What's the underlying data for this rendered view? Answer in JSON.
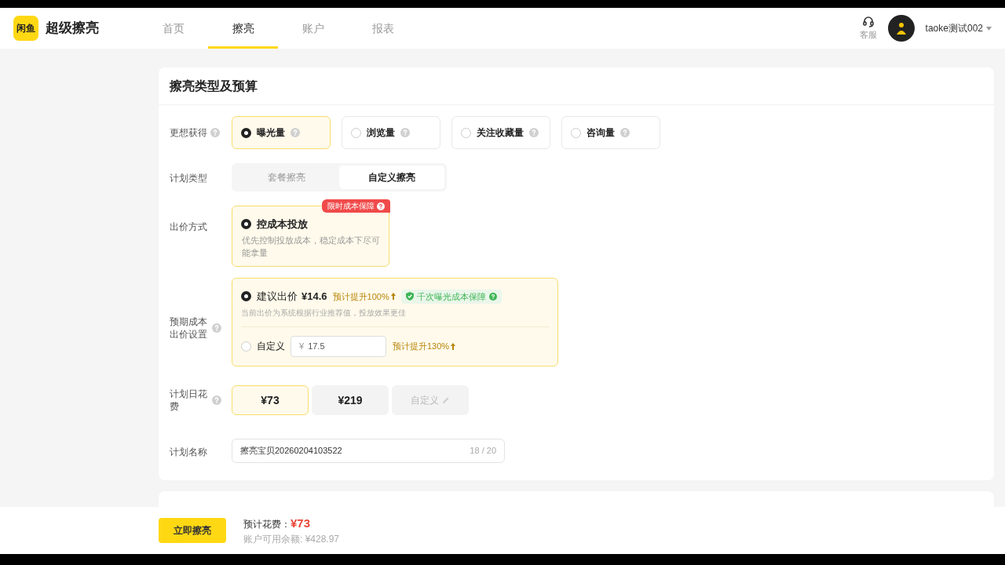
{
  "header": {
    "logo_text": "闲鱼",
    "brand": "超级擦亮",
    "nav": [
      {
        "label": "首页",
        "selected": false
      },
      {
        "label": "擦亮",
        "selected": true
      },
      {
        "label": "账户",
        "selected": false
      },
      {
        "label": "报表",
        "selected": false
      }
    ],
    "service": "客服",
    "username": "taoke测试002"
  },
  "card": {
    "title": "擦亮类型及预算",
    "goal": {
      "label": "更想获得",
      "options": [
        {
          "label": "曝光量",
          "selected": true
        },
        {
          "label": "浏览量",
          "selected": false
        },
        {
          "label": "关注收藏量",
          "selected": false
        },
        {
          "label": "咨询量",
          "selected": false
        }
      ]
    },
    "plan_type": {
      "label": "计划类型",
      "options": [
        {
          "label": "套餐擦亮",
          "selected": false
        },
        {
          "label": "自定义擦亮",
          "selected": true
        }
      ]
    },
    "bid_method": {
      "label": "出价方式",
      "badge": "限时成本保障",
      "title": "控成本投放",
      "description": "优先控制投放成本，稳定成本下尽可能拿量",
      "selected": true
    },
    "cost_setting": {
      "label": "预期成本出价设置",
      "suggested": {
        "selected": true,
        "label": "建议出价",
        "price": "¥14.6",
        "uplift": "预计提升100%",
        "guarantee": "千次曝光成本保障",
        "note": "当前出价为系统根据行业推荐值，投放效果更佳"
      },
      "custom": {
        "selected": false,
        "label": "自定义",
        "currency": "¥",
        "value": "17.5",
        "uplift": "预计提升130%"
      }
    },
    "daily_budget": {
      "label": "计划日花费",
      "options": [
        {
          "kind": "amount",
          "label": "¥73",
          "selected": true
        },
        {
          "kind": "amount",
          "label": "¥219",
          "selected": false
        },
        {
          "kind": "custom",
          "label": "自定义",
          "selected": false
        }
      ]
    },
    "plan_name": {
      "label": "计划名称",
      "value": "擦亮宝贝20260204103522",
      "counter": "18 / 20"
    }
  },
  "footer": {
    "button": "立即擦亮",
    "cost_label": "预计花费：",
    "cost": "¥73",
    "balance": "账户可用余额: ¥428.97"
  }
}
